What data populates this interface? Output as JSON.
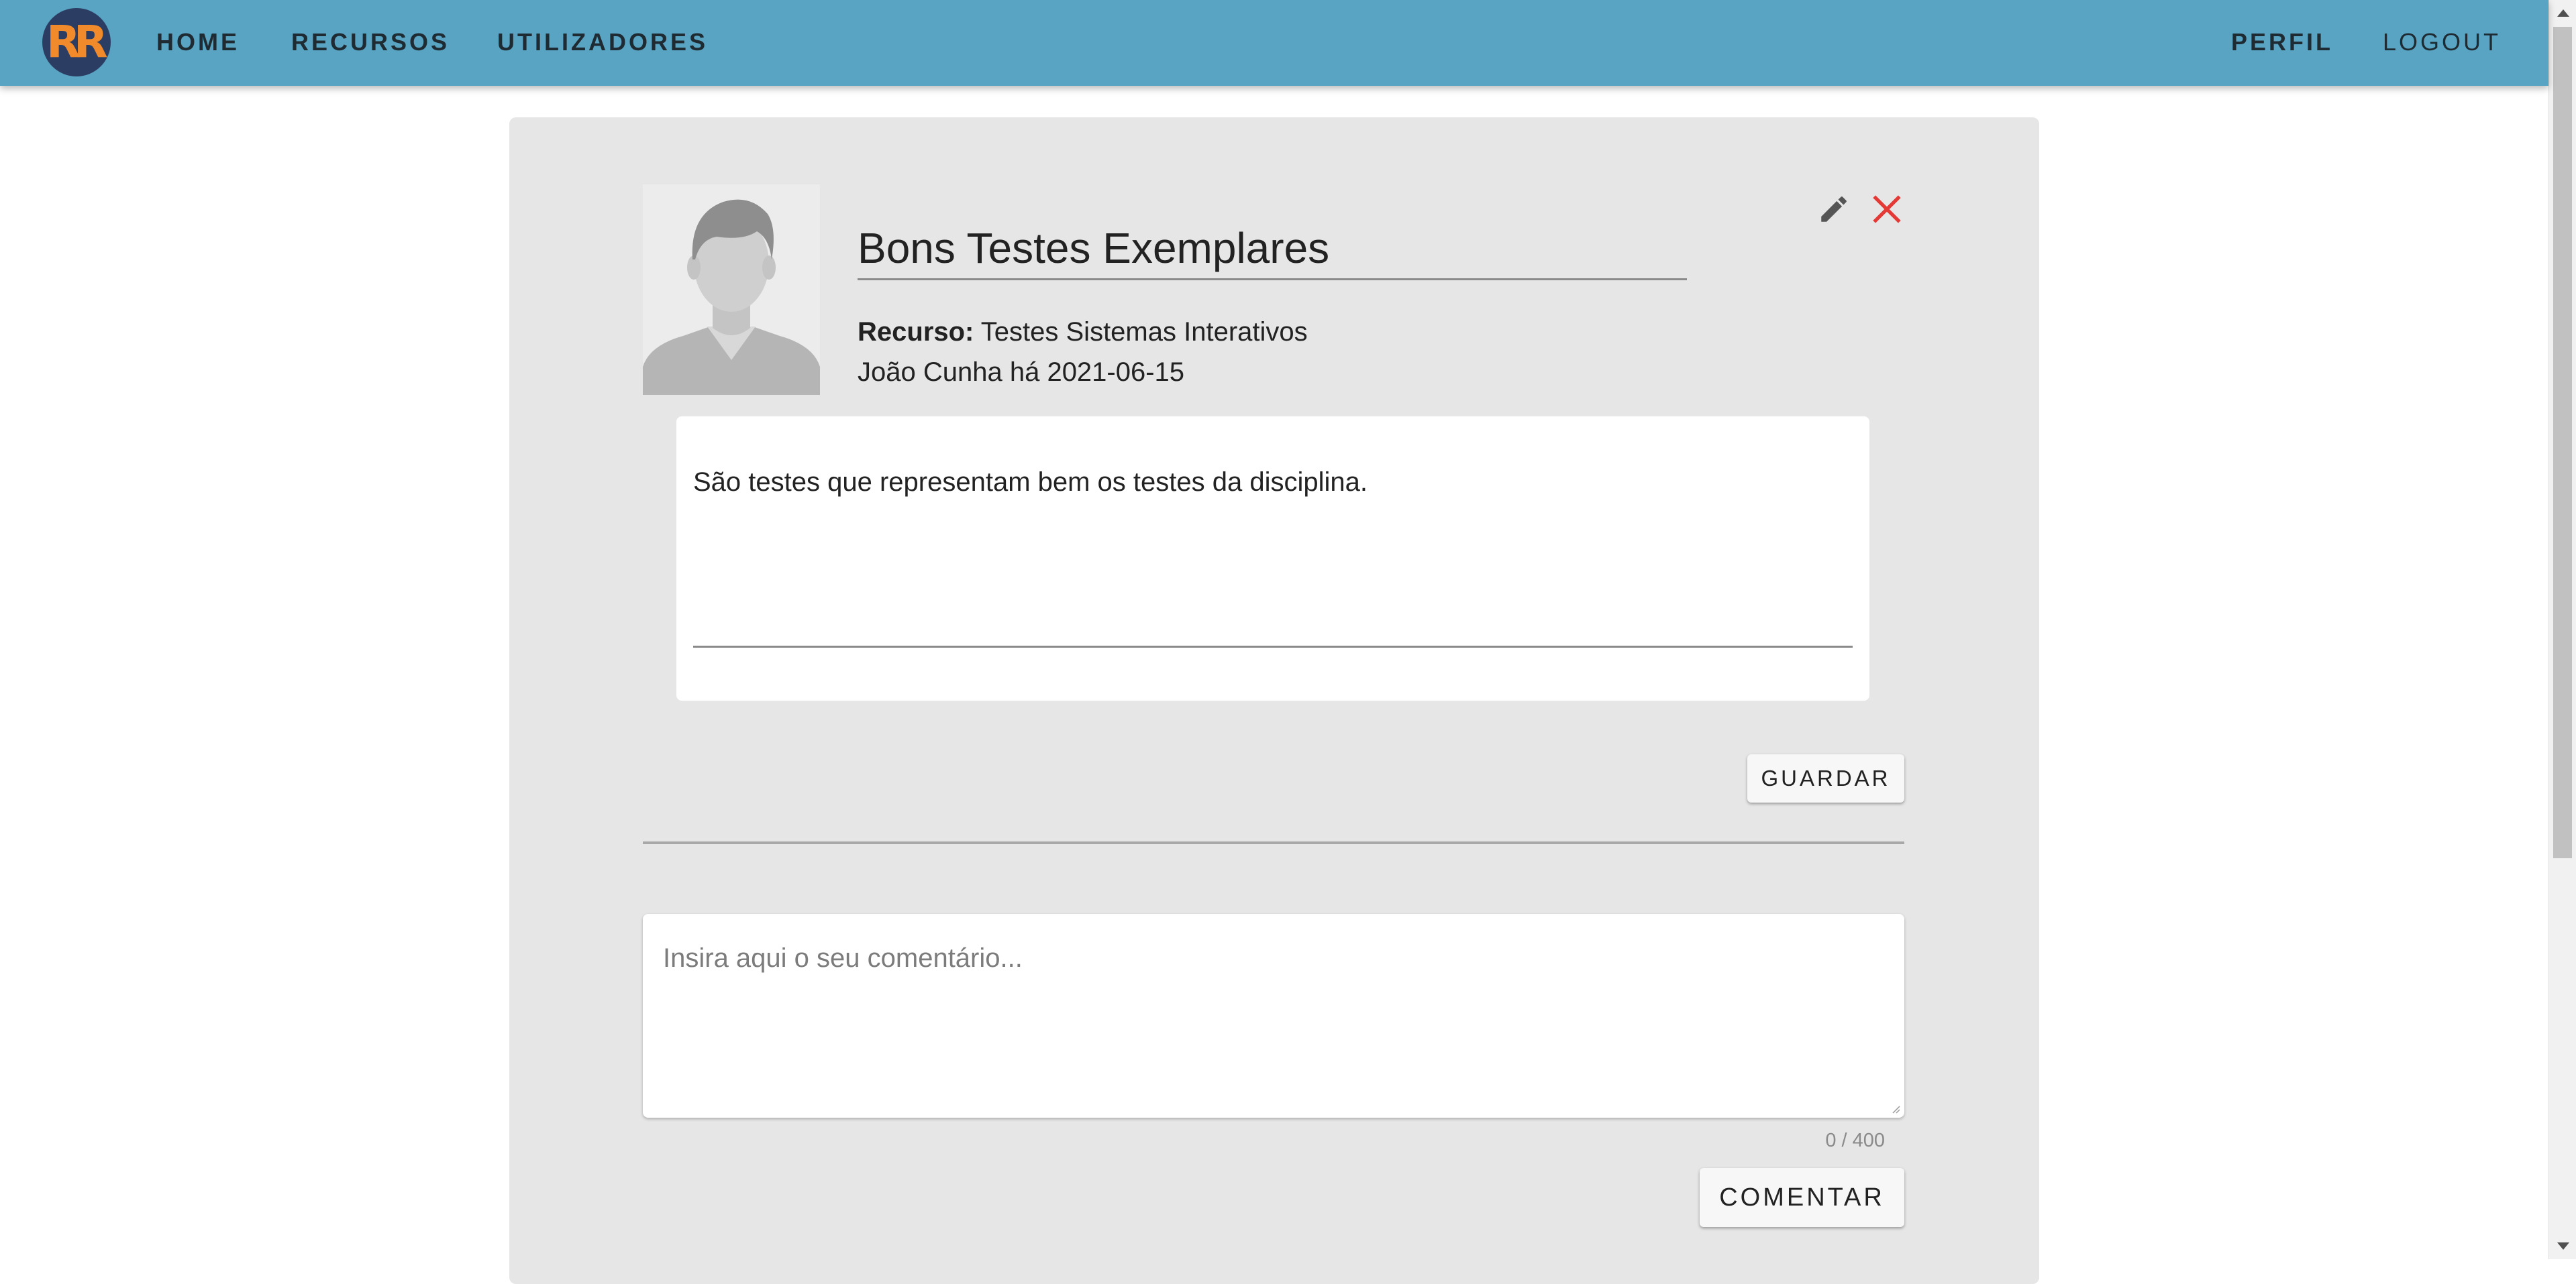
{
  "nav": {
    "logo_text": "RR",
    "home": "HOME",
    "recursos": "RECURSOS",
    "utilizadores": "UTILIZADORES",
    "perfil": "PERFIL",
    "logout": "LOGOUT"
  },
  "review": {
    "title": "Bons Testes Exemplares",
    "resource_label": "Recurso:",
    "resource_name": "Testes Sistemas Interativos",
    "author_line": "João Cunha há 2021-06-15",
    "body": "São testes que representam bem os testes da disciplina."
  },
  "actions": {
    "save_label": "GUARDAR",
    "edit_icon": "pencil-icon",
    "delete_icon": "close-icon"
  },
  "comment": {
    "placeholder": "Insira aqui o seu comentário...",
    "counter": "0 / 400",
    "submit_label": "COMENTAR"
  },
  "colors": {
    "navbar": "#59a4c2",
    "logo_bg": "#2c3d63",
    "logo_fg": "#f08a2b",
    "card_bg": "#e6e6e6",
    "delete_icon": "#e53935"
  }
}
